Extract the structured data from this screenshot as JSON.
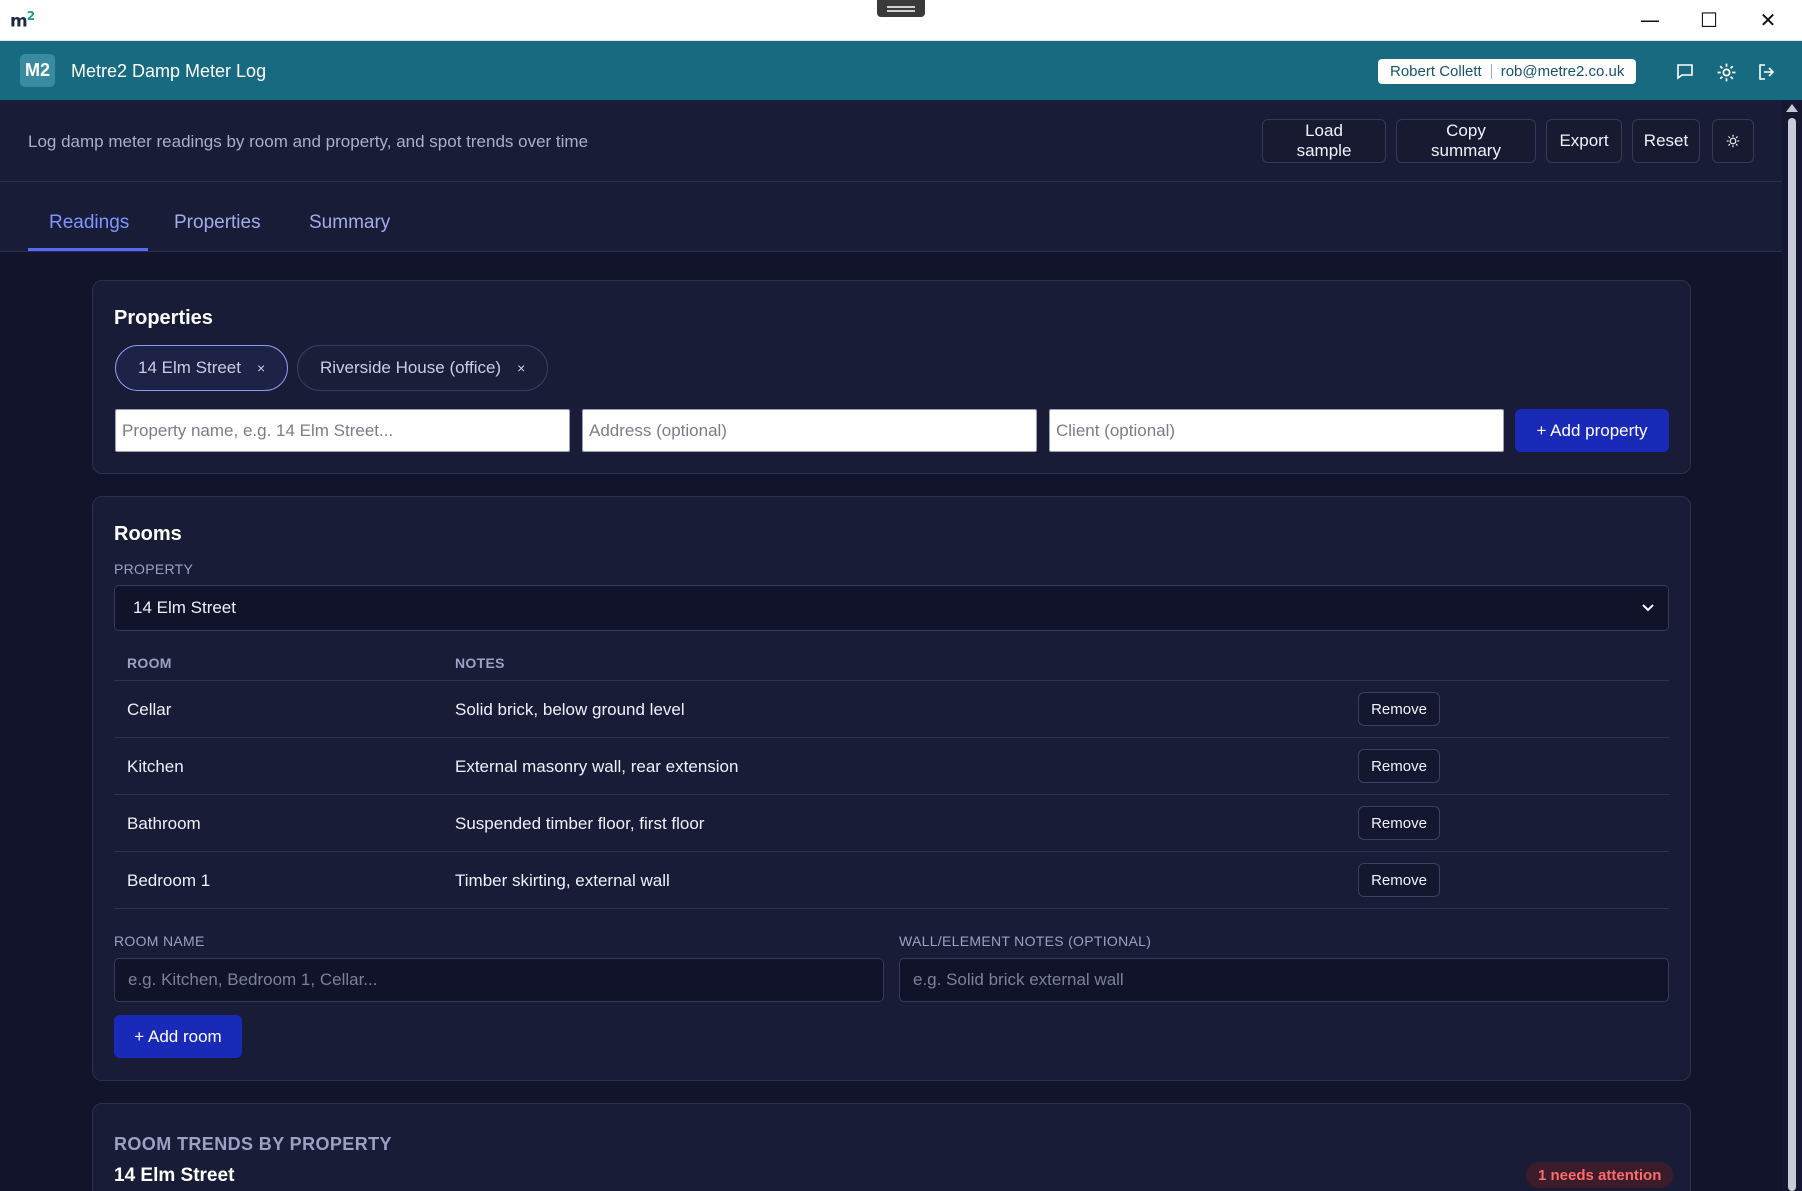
{
  "os": {
    "logo_text": "m",
    "logo_sup": "2",
    "minimize": "—",
    "maximize": "☐",
    "close": "✕"
  },
  "header": {
    "badge": "M2",
    "title": "Metre2 Damp Meter Log",
    "user_name": "Robert Collett",
    "user_email": "rob@metre2.co.uk",
    "icons": [
      "chat-icon",
      "settings-icon",
      "logout-icon"
    ]
  },
  "toolbar": {
    "tagline": "Log damp meter readings by room and property, and spot trends over time",
    "load_sample": "Load sample",
    "copy_summary": "Copy summary",
    "export": "Export",
    "reset": "Reset",
    "theme_icon": "sun-icon"
  },
  "tabs": [
    {
      "label": "Readings",
      "active": true
    },
    {
      "label": "Properties",
      "active": false
    },
    {
      "label": "Summary",
      "active": false
    }
  ],
  "properties": {
    "title": "Properties",
    "chips": [
      {
        "label": "14 Elm Street",
        "active": true
      },
      {
        "label": "Riverside House (office)",
        "active": false
      }
    ],
    "remove_glyph": "×",
    "name_placeholder": "Property name, e.g. 14 Elm Street...",
    "address_placeholder": "Address (optional)",
    "client_placeholder": "Client (optional)",
    "add_button": "+ Add property"
  },
  "rooms": {
    "title": "Rooms",
    "property_label": "PROPERTY",
    "selected_property": "14 Elm Street",
    "columns": [
      "ROOM",
      "NOTES"
    ],
    "rows": [
      {
        "room": "Cellar",
        "notes": "Solid brick, below ground level",
        "action": "Remove"
      },
      {
        "room": "Kitchen",
        "notes": "External masonry wall, rear extension",
        "action": "Remove"
      },
      {
        "room": "Bathroom",
        "notes": "Suspended timber floor, first floor",
        "action": "Remove"
      },
      {
        "room": "Bedroom 1",
        "notes": "Timber skirting, external wall",
        "action": "Remove"
      }
    ],
    "room_name_label": "ROOM NAME",
    "room_name_placeholder": "e.g. Kitchen, Bedroom 1, Cellar...",
    "notes_label": "WALL/ELEMENT NOTES (OPTIONAL)",
    "notes_placeholder": "e.g. Solid brick external wall",
    "add_button": "+ Add room"
  },
  "trends": {
    "caption": "ROOM TRENDS BY PROPERTY",
    "property": "14 Elm Street",
    "attention_badge": "1 needs attention"
  },
  "colors": {
    "header_bg": "#176a7f",
    "page_bg": "#11142a",
    "card_bg": "#191c36",
    "accent": "#7f95ff",
    "primary_button": "#1a2ab8",
    "alert": "#ff6a6a"
  }
}
